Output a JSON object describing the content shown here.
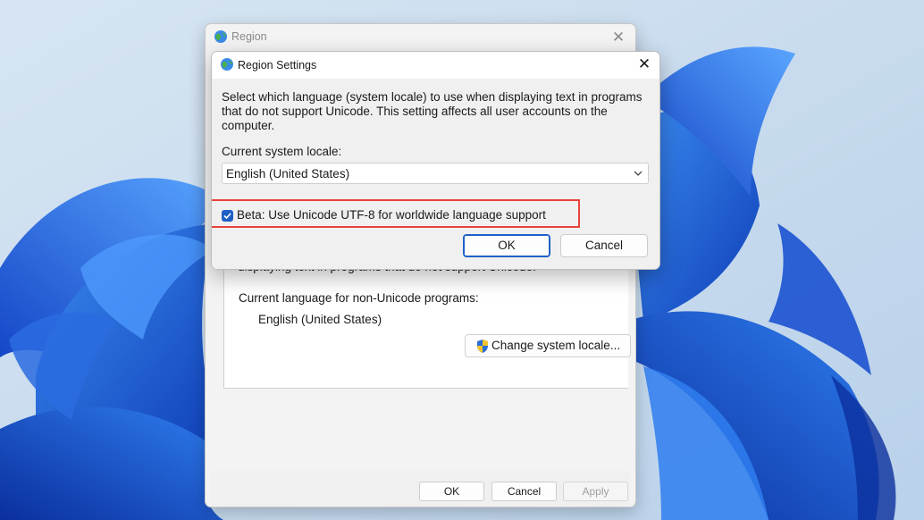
{
  "region_window": {
    "title": "Region",
    "close_glyph": "✕",
    "panel_partial_text": "displaying text in programs that do not support Unicode.",
    "non_unicode_label": "Current language for non-Unicode programs:",
    "non_unicode_value": "English (United States)",
    "change_locale_label": "Change system locale...",
    "footer": {
      "ok": "OK",
      "cancel": "Cancel",
      "apply": "Apply"
    }
  },
  "region_settings_dialog": {
    "title": "Region Settings",
    "close_glyph": "✕",
    "description": "Select which language (system locale) to use when displaying text in programs that do not support Unicode. This setting affects all user accounts on the computer.",
    "current_locale_label": "Current system locale:",
    "current_locale_value": "English (United States)",
    "utf8_checkbox_label": "Beta: Use Unicode UTF-8 for worldwide language support",
    "utf8_checked": true,
    "ok_label": "OK",
    "cancel_label": "Cancel"
  },
  "icons": {
    "app": "globe-icon",
    "shield": "uac-shield-icon",
    "dropdown": "chevron-down-icon",
    "check": "checkmark-icon"
  },
  "colors": {
    "accent": "#1f5fc7",
    "highlight": "#e8433a",
    "desktop_bg": "#c9dcee",
    "bloom_blue": "#1f5fd8"
  }
}
